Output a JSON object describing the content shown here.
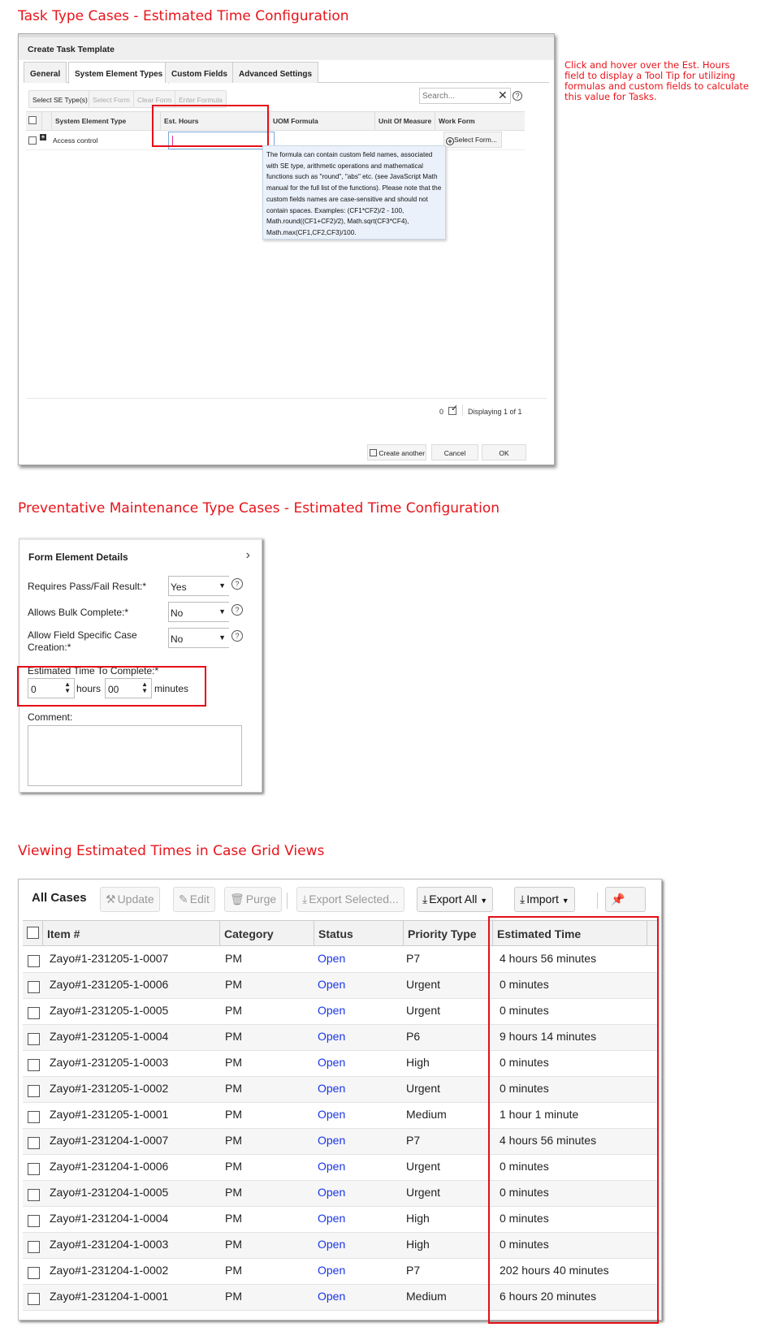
{
  "sections": {
    "task_title": "Task Type Cases - Estimated Time Configuration",
    "task_note": "Click and hover over the Est. Hours field to display a Tool Tip for utilizing formulas and custom fields to calculate this value for Tasks.",
    "pm_title": "Preventative Maintenance Type Cases - Estimated Time Configuration",
    "grid_title": "Viewing Estimated Times in Case Grid Views"
  },
  "task_dialog": {
    "title": "Create Task Template",
    "tabs": [
      {
        "label": "General",
        "active": false
      },
      {
        "label": "System Element Types",
        "active": true
      },
      {
        "label": "Custom Fields",
        "active": false
      },
      {
        "label": "Advanced Settings",
        "active": false
      }
    ],
    "toolbar": {
      "select_se_types": "Select SE Type(s)",
      "select_form": "Select Form",
      "clear_form": "Clear Form",
      "enter_formula": "Enter Formula",
      "search_placeholder": "Search...",
      "clear_icon": "✕",
      "help_icon": "?"
    },
    "columns": [
      "System Element Type",
      "Est. Hours",
      "UOM Formula",
      "Unit Of Measure",
      "Work Form"
    ],
    "rows": [
      {
        "system_element_type": "Access control",
        "est_hours": "",
        "uom_formula": "",
        "unit_of_measure": "",
        "work_form_button": "Select Form..."
      }
    ],
    "tooltip": "The formula can contain custom field names, associated with SE type, arithmetic operations and mathematical functions such as \"round\", \"abs\" etc. (see JavaScript Math manual for the full list of the functions). Please note that the custom fields names are case-sensitive and should not contain spaces. Examples: (CF1*CF2)/2 - 100, Math.round((CF1+CF2)/2), Math.sqrt(CF3*CF4), Math.max(CF1,CF2,CF3)/100.",
    "footer": {
      "selected_count": "0",
      "displaying": "Displaying 1 of 1",
      "create_another": "Create another",
      "cancel": "Cancel",
      "ok": "OK"
    }
  },
  "pm_panel": {
    "title": "Form Element Details",
    "fields": [
      {
        "label": "Requires Pass/Fail Result:*",
        "value": "Yes"
      },
      {
        "label": "Allows Bulk Complete:*",
        "value": "No"
      },
      {
        "label": "Allow Field Specific Case Creation:*",
        "value": "No"
      }
    ],
    "estimated_time": {
      "label": "Estimated Time To Complete:*",
      "hours_value": "0",
      "hours_unit": "hours",
      "minutes_value": "00",
      "minutes_unit": "minutes"
    },
    "comment_label": "Comment:",
    "comment_value": ""
  },
  "case_grid": {
    "title": "All Cases",
    "toolbar": {
      "update": "Update",
      "edit": "Edit",
      "purge": "Purge",
      "export_selected": "Export Selected...",
      "export_all": "Export All",
      "import": "Import"
    },
    "columns": [
      "Item #",
      "Category",
      "Status",
      "Priority Type",
      "Estimated Time"
    ],
    "rows": [
      {
        "item": "Zayo#1-231205-1-0007",
        "category": "PM",
        "status": "Open",
        "priority": "P7",
        "estimated_time": "4 hours 56 minutes"
      },
      {
        "item": "Zayo#1-231205-1-0006",
        "category": "PM",
        "status": "Open",
        "priority": "Urgent",
        "estimated_time": "0 minutes"
      },
      {
        "item": "Zayo#1-231205-1-0005",
        "category": "PM",
        "status": "Open",
        "priority": "Urgent",
        "estimated_time": "0 minutes"
      },
      {
        "item": "Zayo#1-231205-1-0004",
        "category": "PM",
        "status": "Open",
        "priority": "P6",
        "estimated_time": "9 hours 14 minutes"
      },
      {
        "item": "Zayo#1-231205-1-0003",
        "category": "PM",
        "status": "Open",
        "priority": "High",
        "estimated_time": "0 minutes"
      },
      {
        "item": "Zayo#1-231205-1-0002",
        "category": "PM",
        "status": "Open",
        "priority": "Urgent",
        "estimated_time": "0 minutes"
      },
      {
        "item": "Zayo#1-231205-1-0001",
        "category": "PM",
        "status": "Open",
        "priority": "Medium",
        "estimated_time": "1 hour 1 minute"
      },
      {
        "item": "Zayo#1-231204-1-0007",
        "category": "PM",
        "status": "Open",
        "priority": "P7",
        "estimated_time": "4 hours 56 minutes"
      },
      {
        "item": "Zayo#1-231204-1-0006",
        "category": "PM",
        "status": "Open",
        "priority": "Urgent",
        "estimated_time": "0 minutes"
      },
      {
        "item": "Zayo#1-231204-1-0005",
        "category": "PM",
        "status": "Open",
        "priority": "Urgent",
        "estimated_time": "0 minutes"
      },
      {
        "item": "Zayo#1-231204-1-0004",
        "category": "PM",
        "status": "Open",
        "priority": "High",
        "estimated_time": "0 minutes"
      },
      {
        "item": "Zayo#1-231204-1-0003",
        "category": "PM",
        "status": "Open",
        "priority": "High",
        "estimated_time": "0 minutes"
      },
      {
        "item": "Zayo#1-231204-1-0002",
        "category": "PM",
        "status": "Open",
        "priority": "P7",
        "estimated_time": "202 hours 40 minutes"
      },
      {
        "item": "Zayo#1-231204-1-0001",
        "category": "PM",
        "status": "Open",
        "priority": "Medium",
        "estimated_time": "6 hours 20 minutes"
      }
    ]
  },
  "colors": {
    "annotation_red": "#e8141b",
    "link_blue": "#1a35e6",
    "tooltip_bg": "#eaf1fa"
  }
}
